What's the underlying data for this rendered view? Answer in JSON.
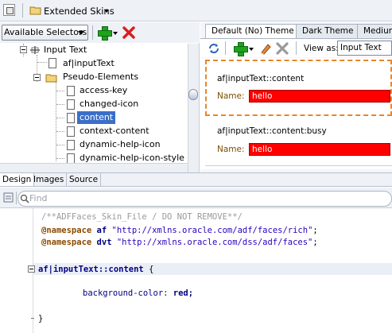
{
  "toolbar": {
    "skins_label": "Extended Skins",
    "skins_icon": "folder-icon"
  },
  "selectors": {
    "dropdown_label": "Available Selectors",
    "add_icon": "plus-icon",
    "delete_icon": "x-icon"
  },
  "tree": {
    "items": [
      {
        "label": "Input Text",
        "icon": "component-icon"
      },
      {
        "label": "af|inputText",
        "icon": "page-icon"
      },
      {
        "label": "Pseudo-Elements",
        "icon": "folder-icon"
      },
      {
        "label": "access-key",
        "icon": "page-icon"
      },
      {
        "label": "changed-icon",
        "icon": "page-icon"
      },
      {
        "label": "content",
        "icon": "page-icon",
        "selected": true
      },
      {
        "label": "context-content",
        "icon": "page-icon"
      },
      {
        "label": "dynamic-help-icon",
        "icon": "page-icon"
      },
      {
        "label": "dynamic-help-icon-style",
        "icon": "page-icon"
      }
    ]
  },
  "theme_tabs": [
    {
      "label": "Default (No) Theme",
      "active": true
    },
    {
      "label": "Dark Theme",
      "active": false
    },
    {
      "label": "Medium",
      "active": false
    }
  ],
  "preview_toolbar": {
    "view_label": "View as:",
    "view_value": "Input Text"
  },
  "preview": {
    "cards": [
      {
        "title": "af|inputText::content",
        "name_label": "Name:",
        "value": "hello"
      },
      {
        "title": "af|inputText::content:busy",
        "name_label": "Name:",
        "value": "hello"
      }
    ]
  },
  "bottom_tabs": [
    {
      "label": "Design",
      "active": true
    },
    {
      "label": "Images",
      "active": false
    },
    {
      "label": "Source",
      "active": false
    }
  ],
  "find": {
    "placeholder": "Find"
  },
  "code": {
    "line1": "/**ADFFaces_Skin_File / DO NOT REMOVE**/",
    "ns_keyword": "@namespace",
    "ns1_prefix": "af",
    "ns1_url": "\"http://xmlns.oracle.com/adf/faces/rich\"",
    "ns2_prefix": "dvt",
    "ns2_url": "\"http://xmlns.oracle.com/dss/adf/faces\"",
    "semicolon": ";",
    "selector": "af|inputText::content",
    "open_brace": " {",
    "property": "background-color:",
    "prop_value": " red;",
    "close_brace": "}"
  },
  "colors": {
    "accent_selection": "#3b6fc7",
    "focus_border": "#e8862a",
    "preview_red": "#ff0000"
  }
}
